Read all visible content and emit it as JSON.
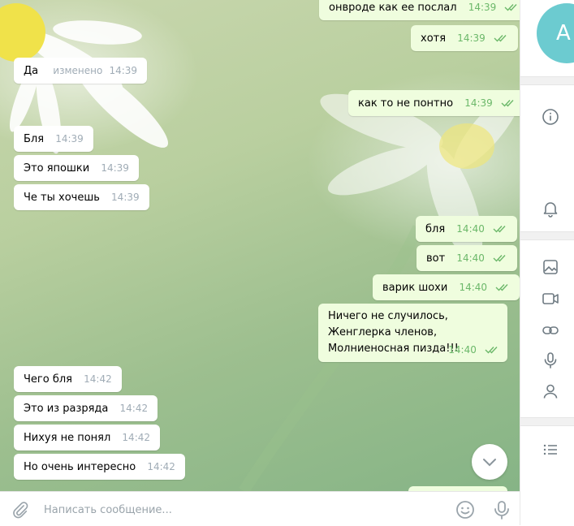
{
  "chat": {
    "messages": [
      {
        "dir": "out",
        "text": "онвроде как ее послал",
        "time": "14:39"
      },
      {
        "dir": "out",
        "text": "хотя",
        "time": "14:39"
      },
      {
        "dir": "in",
        "text": "Да",
        "edited": "изменено",
        "time": "14:39"
      },
      {
        "dir": "out",
        "text": "как то не понтно",
        "time": "14:39"
      },
      {
        "dir": "in",
        "text": "Бля",
        "time": "14:39"
      },
      {
        "dir": "in",
        "text": "Это япошки",
        "time": "14:39"
      },
      {
        "dir": "in",
        "text": "Че ты хочешь",
        "time": "14:39"
      },
      {
        "dir": "out",
        "text": "бля",
        "time": "14:40"
      },
      {
        "dir": "out",
        "text": "вот",
        "time": "14:40"
      },
      {
        "dir": "out",
        "text": "варик шохи",
        "time": "14:40"
      },
      {
        "dir": "out",
        "lines": [
          "Ничего не случилось,",
          "Женглерка членов,",
          "Молниеносная пизда!!!"
        ],
        "time": "14:40"
      },
      {
        "dir": "in",
        "text": "Чего бля",
        "time": "14:42"
      },
      {
        "dir": "in",
        "text": "Это из разряда",
        "time": "14:42"
      },
      {
        "dir": "in",
        "text": "Нихуя не понял",
        "time": "14:42"
      },
      {
        "dir": "in",
        "text": "Но очень интересно",
        "time": "14:42"
      }
    ]
  },
  "compose": {
    "placeholder": "Написать сообщение..."
  },
  "sidebar": {
    "avatar_letter": "A",
    "avatar_color": "#6ccbd0"
  },
  "icons": {
    "attach": "paperclip-icon",
    "emoji": "smiley-icon",
    "mic": "microphone-icon",
    "info": "info-icon",
    "bell": "bell-icon",
    "photo": "photo-icon",
    "video": "video-icon",
    "link": "link-icon",
    "voice": "microphone-icon",
    "members": "user-icon",
    "list": "list-icon",
    "scroll": "chevron-down-icon"
  },
  "colors": {
    "outgoing_bubble": "#effdde",
    "incoming_bubble": "#ffffff",
    "check_color": "#6cb86a",
    "accent": "#6ccbd0"
  }
}
